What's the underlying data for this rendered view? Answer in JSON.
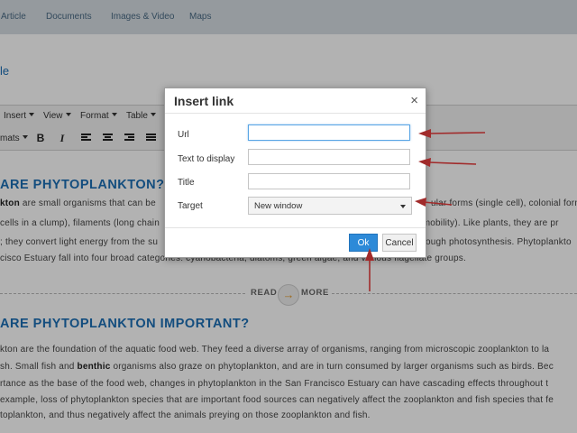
{
  "nav": {
    "tabs": [
      "Article",
      "Documents",
      "Images & Video",
      "Maps"
    ]
  },
  "page": {
    "heading_fragment": "le"
  },
  "editor": {
    "menus": [
      "Insert",
      "View",
      "Format",
      "Table"
    ],
    "formats_label": "mats",
    "bold": "B",
    "italic": "I"
  },
  "article": {
    "heading1": "ARE PHYTOPLANKTON?",
    "p1_lines": [
      [
        "kton",
        " are small organisms that can be",
        "ular forms (single cell), colonial form"
      ],
      [
        "cells in a clump), filaments (long chain",
        "e mobility). Like plants, they are pr"
      ],
      [
        "; they convert light energy from the su",
        "ough photosynthesis. Phytoplankto"
      ],
      [
        "cisco Estuary fall into four broad categories: cyanobacteria, diatoms, green algae, and various flagellate groups."
      ]
    ],
    "read": "READ",
    "more": "MORE",
    "arrow": "→",
    "heading2": "ARE PHYTOPLANKTON IMPORTANT?",
    "p2_lines": [
      [
        "kton are the foundation of the aquatic food web. They feed a diverse array of organisms, ranging from microscopic zooplankton to la"
      ],
      [
        "sh. Small fish and ",
        "benthic",
        " organisms also graze on phytoplankton, and are in turn consumed by larger organisms such as birds. Bec"
      ],
      [
        "rtance as the base of the food web, changes in phytoplankton in the San Francisco Estuary can have cascading effects throughout t"
      ],
      [
        "example, loss of phytoplankton species that are important food sources can negatively affect the zooplankton and fish species that fe"
      ],
      [
        "toplankton, and thus negatively affect the animals preying on those zooplankton and fish."
      ]
    ]
  },
  "dialog": {
    "title": "Insert link",
    "close": "×",
    "fields": [
      {
        "label": "Url",
        "value": ""
      },
      {
        "label": "Text to display",
        "value": ""
      },
      {
        "label": "Title",
        "value": ""
      }
    ],
    "target_label": "Target",
    "target_value": "New window",
    "ok": "Ok",
    "cancel": "Cancel"
  },
  "colors": {
    "accent": "#1c6fb5",
    "primary_button": "#2d8ad8",
    "annotation_arrow": "#a12b2b"
  }
}
